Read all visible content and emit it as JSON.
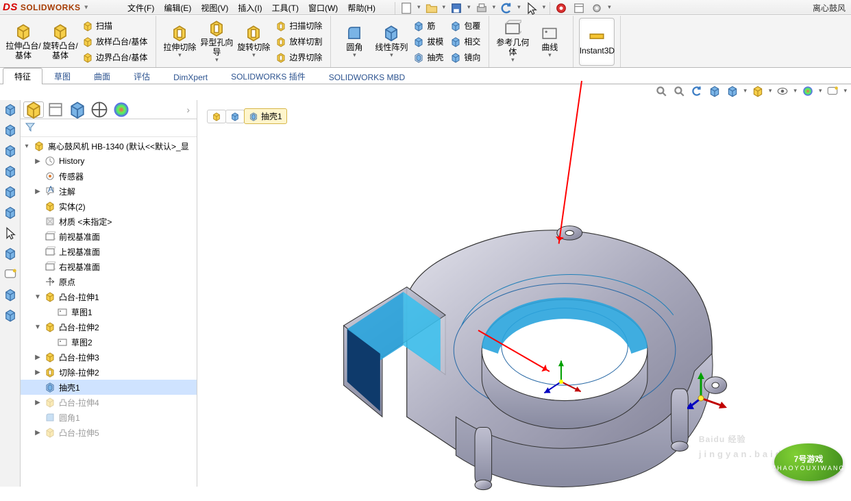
{
  "app": {
    "brand": "SOLIDWORKS",
    "doc_title_fragment": "离心鼓风"
  },
  "menus": [
    "文件(F)",
    "编辑(E)",
    "视图(V)",
    "插入(I)",
    "工具(T)",
    "窗口(W)",
    "帮助(H)"
  ],
  "ribbon": {
    "g1_big1": "拉伸凸台/基体",
    "g1_big2": "旋转凸台/基体",
    "g1_small": [
      "扫描",
      "放样凸台/基体",
      "边界凸台/基体"
    ],
    "g2_big1": "拉伸切除",
    "g2_big2": "异型孔向导",
    "g2_big3": "旋转切除",
    "g2_small": [
      "扫描切除",
      "放样切割",
      "边界切除"
    ],
    "g3_big1": "圆角",
    "g3_big2": "线性阵列",
    "g3_small": [
      "筋",
      "拔模",
      "抽壳"
    ],
    "g3_small2": [
      "包覆",
      "相交",
      "镜向"
    ],
    "g4_big1": "参考几何体",
    "g4_big2": "曲线",
    "g5_big": "Instant3D"
  },
  "tabs": [
    "特征",
    "草图",
    "曲面",
    "评估",
    "DimXpert",
    "SOLIDWORKS 插件",
    "SOLIDWORKS MBD"
  ],
  "breadcrumb": {
    "last": "抽壳1"
  },
  "tree": {
    "root": "离心鼓风机 HB-1340  (默认<<默认>_显",
    "items": [
      {
        "label": "History",
        "icon": "history",
        "depth": 1,
        "twist": "▶"
      },
      {
        "label": "传感器",
        "icon": "sensor",
        "depth": 1
      },
      {
        "label": "注解",
        "icon": "annot",
        "depth": 1,
        "twist": "▶"
      },
      {
        "label": "实体(2)",
        "icon": "solid",
        "depth": 1
      },
      {
        "label": "材质 <未指定>",
        "icon": "material",
        "depth": 1
      },
      {
        "label": "前视基准面",
        "icon": "plane",
        "depth": 1
      },
      {
        "label": "上视基准面",
        "icon": "plane",
        "depth": 1
      },
      {
        "label": "右视基准面",
        "icon": "plane",
        "depth": 1
      },
      {
        "label": "原点",
        "icon": "origin",
        "depth": 1
      },
      {
        "label": "凸台-拉伸1",
        "icon": "feat-extrude",
        "depth": 1,
        "twist": "▼"
      },
      {
        "label": "草图1",
        "icon": "sketch",
        "depth": 2
      },
      {
        "label": "凸台-拉伸2",
        "icon": "feat-extrude",
        "depth": 1,
        "twist": "▼"
      },
      {
        "label": "草图2",
        "icon": "sketch",
        "depth": 2
      },
      {
        "label": "凸台-拉伸3",
        "icon": "feat-extrude",
        "depth": 1,
        "twist": "▶"
      },
      {
        "label": "切除-拉伸2",
        "icon": "feat-cut",
        "depth": 1,
        "twist": "▶"
      },
      {
        "label": "抽壳1",
        "icon": "feat-shell",
        "depth": 1,
        "selected": true
      },
      {
        "label": "凸台-拉伸4",
        "icon": "feat-extrude",
        "depth": 1,
        "twist": "▶",
        "ghost": true
      },
      {
        "label": "圆角1",
        "icon": "feat-fillet",
        "depth": 1,
        "ghost": true
      },
      {
        "label": "凸台-拉伸5",
        "icon": "feat-extrude",
        "depth": 1,
        "twist": "▶",
        "ghost": true
      }
    ]
  },
  "watermark": {
    "text": "Baidu 经验",
    "sub": "jingyan.baidu.com",
    "badge_top": "7号游戏",
    "badge_sub": "ZHAOYOUXIWANG"
  }
}
